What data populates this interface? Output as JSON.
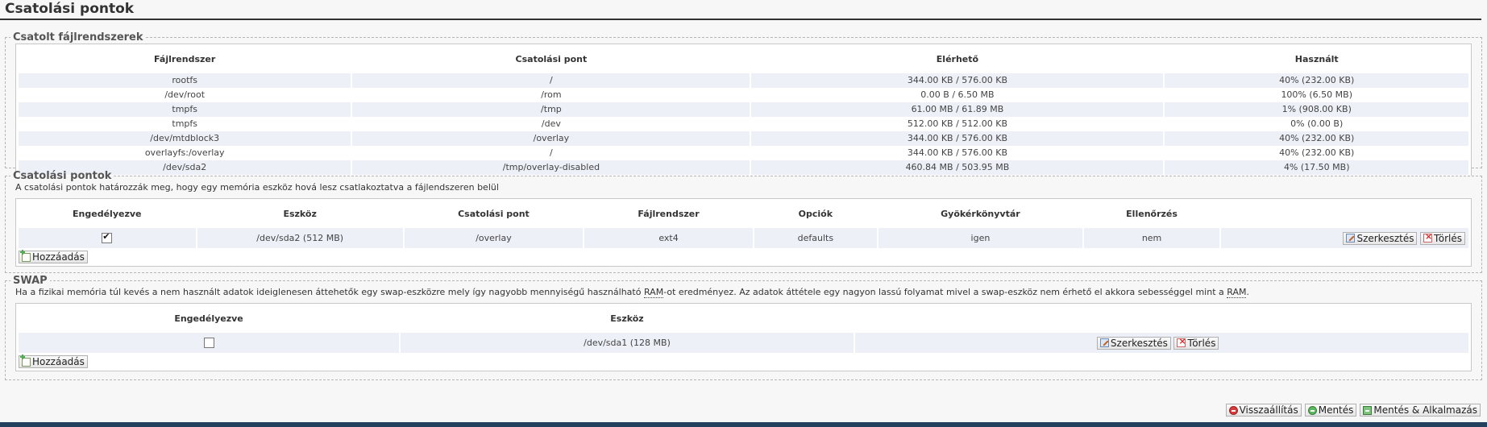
{
  "page": {
    "title": "Csatolási pontok"
  },
  "mounted": {
    "legend": "Csatolt fájlrendszerek",
    "columns": [
      "Fájlrendszer",
      "Csatolási pont",
      "Elérhető",
      "Használt"
    ],
    "rows": [
      [
        "rootfs",
        "/",
        "344.00 KB / 576.00 KB",
        "40% (232.00 KB)"
      ],
      [
        "/dev/root",
        "/rom",
        "0.00 B / 6.50 MB",
        "100% (6.50 MB)"
      ],
      [
        "tmpfs",
        "/tmp",
        "61.00 MB / 61.89 MB",
        "1% (908.00 KB)"
      ],
      [
        "tmpfs",
        "/dev",
        "512.00 KB / 512.00 KB",
        "0% (0.00 B)"
      ],
      [
        "/dev/mtdblock3",
        "/overlay",
        "344.00 KB / 576.00 KB",
        "40% (232.00 KB)"
      ],
      [
        "overlayfs:/overlay",
        "/",
        "344.00 KB / 576.00 KB",
        "40% (232.00 KB)"
      ],
      [
        "/dev/sda2",
        "/tmp/overlay-disabled",
        "460.84 MB / 503.95 MB",
        "4% (17.50 MB)"
      ]
    ]
  },
  "mountpoints": {
    "legend": "Csatolási pontok",
    "description": "A csatolási pontok határozzák meg, hogy egy memória eszköz hová lesz csatlakoztatva a fájlendszeren belül",
    "columns": [
      "Engedélyezve",
      "Eszköz",
      "Csatolási pont",
      "Fájlrendszer",
      "Opciók",
      "Gyökérkönyvtár",
      "Ellenőrzés"
    ],
    "row": {
      "enabled": true,
      "device": "/dev/sda2 (512 MB)",
      "mountpoint": "/overlay",
      "filesystem": "ext4",
      "options": "defaults",
      "rootfs": "igen",
      "check": "nem"
    },
    "edit_label": "Szerkesztés",
    "delete_label": "Törlés",
    "add_label": "Hozzáadás"
  },
  "swap": {
    "legend": "SWAP",
    "description_part1": "Ha a fizikai memória túl kevés a nem használt adatok ideiglenesen áttehetők egy swap-eszközre mely így nagyobb mennyiségű használható ",
    "ram1": "RAM",
    "description_part2": "-ot eredményez. Az adatok áttétele egy nagyon lassú folyamat mivel a swap-eszköz nem érhető el akkora sebességgel mint a ",
    "ram2": "RAM",
    "description_part3": ".",
    "columns": [
      "Engedélyezve",
      "Eszköz"
    ],
    "row": {
      "enabled": false,
      "device": "/dev/sda1 (128 MB)"
    },
    "edit_label": "Szerkesztés",
    "delete_label": "Törlés",
    "add_label": "Hozzáadás"
  },
  "footer": {
    "reset_label": "Visszaállítás",
    "save_label": "Mentés",
    "apply_label": "Mentés & Alkalmazás"
  }
}
